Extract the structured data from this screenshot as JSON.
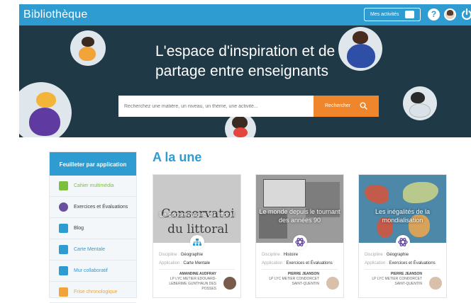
{
  "header": {
    "brand": "Bibliothèque",
    "mes_activites": "Mes activités",
    "help": "?"
  },
  "hero": {
    "title_line1": "L'espace d'inspiration et de",
    "title_line2": "partage entre enseignants",
    "search_placeholder": "Recherchez une matière, un niveau, un thème, une activité...",
    "search_button": "Rechercher"
  },
  "sidebar": {
    "heading": "Feuilleter par application",
    "items": [
      {
        "label": "Cahier multimédia",
        "color": "#7bbf3d"
      },
      {
        "label": "Exercices et Évaluations",
        "color": "#6a4fa0"
      },
      {
        "label": "Blog",
        "color": "#2e9bd1"
      },
      {
        "label": "Carte Mentale",
        "color": "#2e9bd1"
      },
      {
        "label": "Mur collaboratif",
        "color": "#2e9bd1"
      },
      {
        "label": "Frise chronologique",
        "color": "#f0a43a"
      }
    ]
  },
  "main": {
    "section_title": "A la une",
    "cards": [
      {
        "title": "Le conservatoire du littoral",
        "thumb_text": "Conservatoi du littoral",
        "discipline_label": "Discipline :",
        "discipline": "Géographie",
        "application_label": "Application :",
        "application": "Carte Mentale",
        "author": "AMANDINE AUDFRAY",
        "school": "LP LYC METIER EDOUARD-LEBERIME GUNTHAUN DES POSSES"
      },
      {
        "title": "Le monde depuis le tournant des années 90",
        "discipline_label": "Discipline :",
        "discipline": "Histoire",
        "application_label": "Application :",
        "application": "Exercices et Évaluations",
        "author": "PIERRE JEANSON",
        "school": "LP LYC METIER CONDORCET SAINT-QUENTIN"
      },
      {
        "title": "Les inégalités de la mondialisation",
        "discipline_label": "Discipline :",
        "discipline": "Géographie",
        "application_label": "Application :",
        "application": "Exercices et Évaluations",
        "author": "PIERRE JEANSON",
        "school": "LP LYC METIER CONDORCET SAINT-QUENTIN"
      }
    ]
  },
  "colors": {
    "primary": "#2e9bd1",
    "hero_bg": "#1f3947",
    "accent": "#f0862b"
  }
}
